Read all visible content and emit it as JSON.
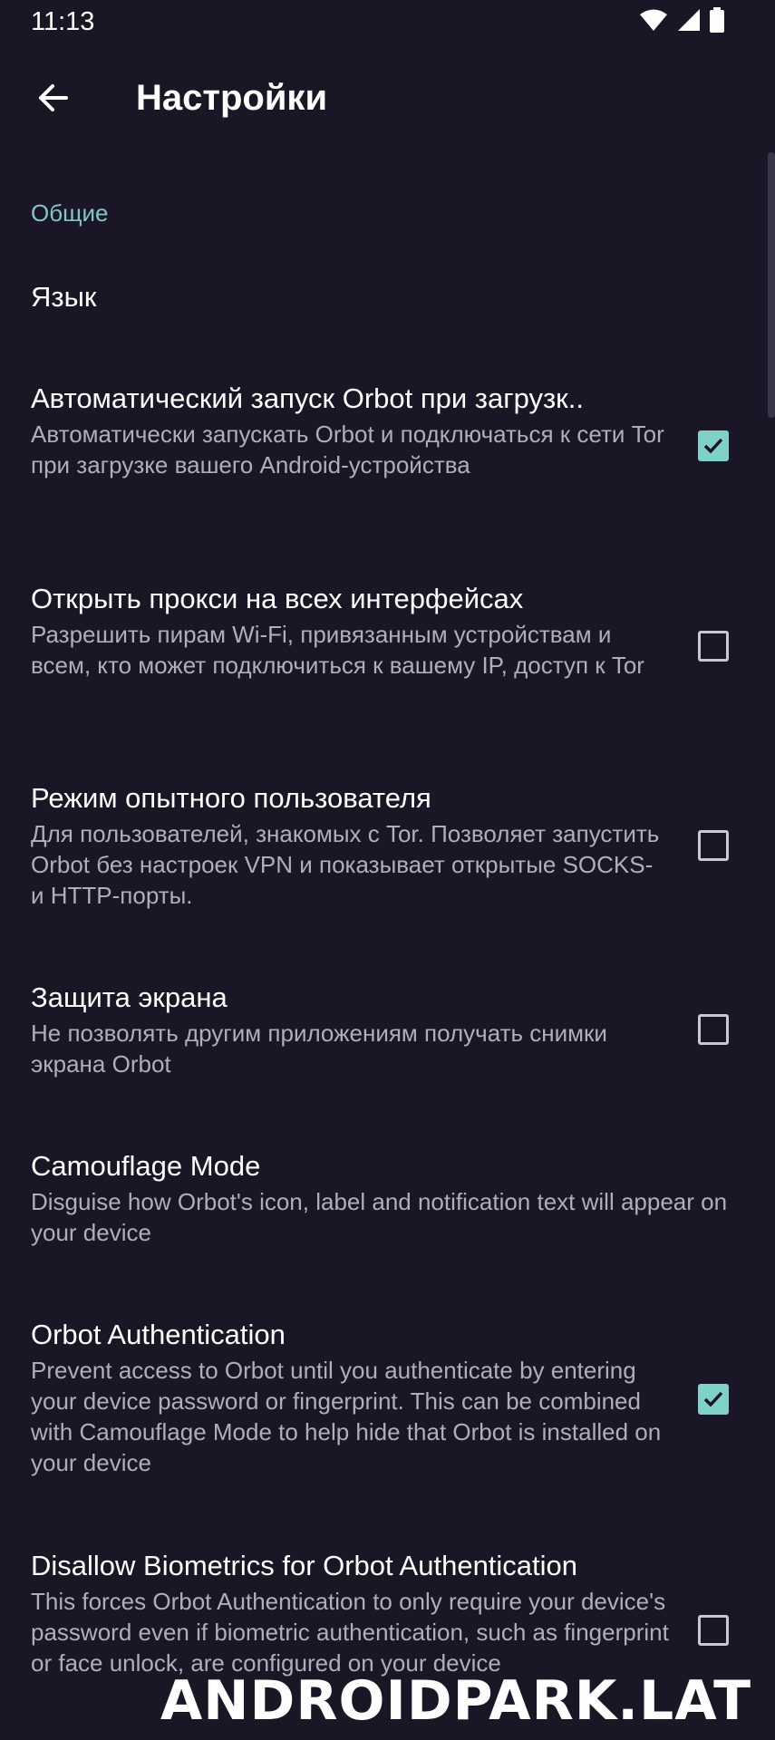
{
  "status_bar": {
    "time": "11:13",
    "icons": [
      "wifi-icon",
      "signal-icon",
      "battery-icon"
    ]
  },
  "app_bar": {
    "title": "Настройки",
    "back_icon": "arrow-back-icon"
  },
  "section": {
    "header": "Общие"
  },
  "prefs": [
    {
      "title": "Язык",
      "summary": ""
    },
    {
      "title": "Автоматический запуск Orbot при загрузк..",
      "summary": "Автоматически запускать Orbot и подключаться к сети Tor при загрузке вашего Android-устройства",
      "checked": true
    },
    {
      "title": "Открыть прокси на всех интерфейсах",
      "summary": "Разрешить пирам Wi-Fi, привязанным устройствам и всем, кто может подключиться к вашему IP, доступ к Tor",
      "checked": false
    },
    {
      "title": "Режим опытного пользователя",
      "summary": "Для пользователей, знакомых с Tor. Позволяет запустить Orbot без настроек VPN и показывает открытые SOCKS- и HTTP-порты.",
      "checked": false
    },
    {
      "title": "Защита экрана",
      "summary": "Не позволять другим приложениям получать снимки экрана Orbot",
      "checked": false
    },
    {
      "title": "Camouflage Mode",
      "summary": "Disguise how Orbot's icon, label and notification text will appear on your device"
    },
    {
      "title": "Orbot Authentication",
      "summary": "Prevent access to Orbot until you authenticate by entering your device password or fingerprint. This can be combined with Camouflage Mode to help hide that Orbot is installed on your device",
      "checked": true
    },
    {
      "title": "Disallow Biometrics for Orbot Authentication",
      "summary": "This forces Orbot Authentication to only require your device's password even if biometric authentication, such as fingerprint or face unlock, are configured on your device",
      "checked": false
    }
  ],
  "colors": {
    "background": "#1a1625",
    "accent": "#80d1c6",
    "section_header": "#80c8c0",
    "summary_text": "#b0aebb"
  },
  "watermark": "ANDROIDPARK.LAT"
}
